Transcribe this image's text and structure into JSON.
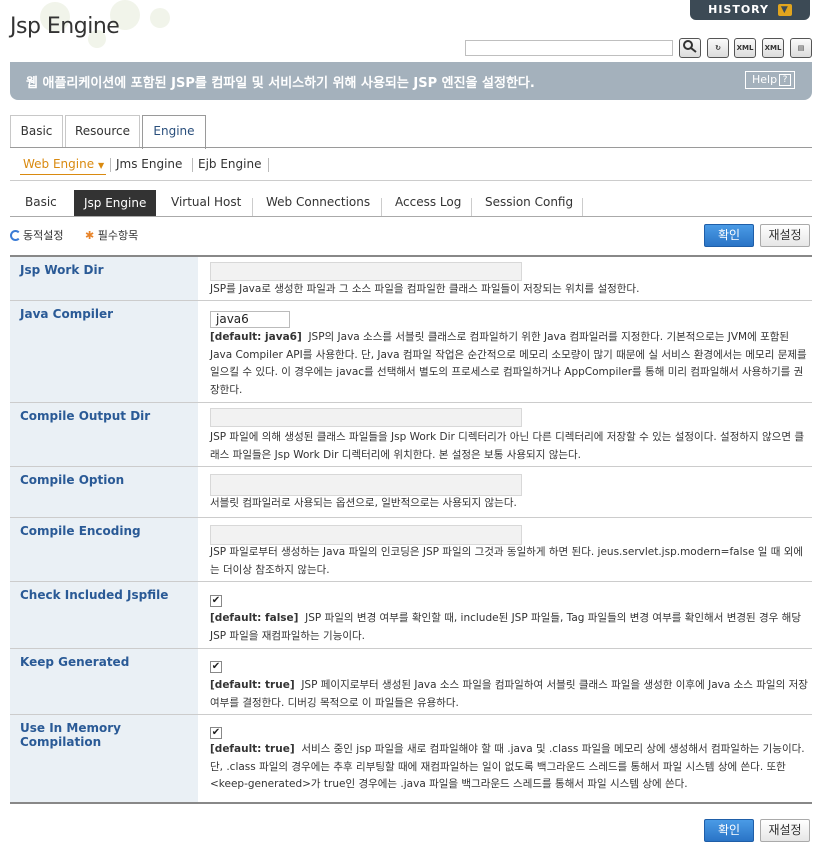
{
  "header": {
    "title": "Jsp Engine",
    "history_label": "HISTORY",
    "description": "웹 애플리케이션에 포함된 JSP를 컴파일 및 서비스하기 위해 사용되는 JSP 엔진을 설정한다.",
    "help_label": "Help",
    "toolbar_icons": [
      "search-icon",
      "refresh-icon",
      "xml-export-icon",
      "xml-view-icon",
      "print-icon"
    ]
  },
  "tabs_main": [
    "Basic",
    "Resource",
    "Engine"
  ],
  "tabs_main_active": "Engine",
  "subnav": [
    "Web Engine",
    "Jms Engine",
    "Ejb Engine"
  ],
  "subnav_active": "Web Engine",
  "tabs_sub": [
    "Basic",
    "Jsp Engine",
    "Virtual Host",
    "Web Connections",
    "Access Log",
    "Session Config"
  ],
  "tabs_sub_active": "Jsp Engine",
  "legend": {
    "dynamic": "동적설정",
    "required": "필수항목"
  },
  "buttons": {
    "confirm": "확인",
    "reset": "재설정"
  },
  "fields": [
    {
      "label": "Jsp Work Dir",
      "type": "text",
      "value": "",
      "default": "",
      "desc": "JSP를 Java로 생성한 파일과 그 소스 파일을 컴파일한 클래스 파일들이 저장되는 위치를 설정한다."
    },
    {
      "label": "Java Compiler",
      "type": "select",
      "value": "java6",
      "default": "[default: java6]",
      "desc": "JSP의 Java 소스를 서블릿 클래스로 컴파일하기 위한 Java 컴파일러를 지정한다. 기본적으로는 JVM에 포함된 Java Compiler API를 사용한다. 단, Java 컴파일 작업은 순간적으로 메모리 소모량이 많기 때문에 실 서비스 환경에서는 메모리 문제를 일으킬 수 있다. 이 경우에는 javac를 선택해서 별도의 프로세스로 컴파일하거나 AppCompiler를 통해 미리 컴파일해서 사용하기를 권장한다."
    },
    {
      "label": "Compile Output Dir",
      "type": "text",
      "value": "",
      "default": "",
      "desc": "JSP 파일에 의해 생성된 클래스 파일들을 Jsp Work Dir 디렉터리가 아닌 다른 디렉터리에 저장할 수 있는 설정이다. 설정하지 않으면 클래스 파일들은 Jsp Work Dir 디렉터리에 위치한다. 본 설정은 보통 사용되지 않는다."
    },
    {
      "label": "Compile Option",
      "type": "text",
      "value": "",
      "default": "",
      "desc": "서블릿 컴파일러로 사용되는 옵션으로, 일반적으로는 사용되지 않는다."
    },
    {
      "label": "Compile Encoding",
      "type": "text",
      "value": "",
      "default": "",
      "desc": "JSP 파일로부터 생성하는 Java 파일의 인코딩은 JSP 파일의 그것과 동일하게 하면 된다. jeus.servlet.jsp.modern=false 일 때 외에는 더이상 참조하지 않는다."
    },
    {
      "label": "Check Included Jspfile",
      "type": "checkbox",
      "value": "true",
      "default": "[default: false]",
      "desc": "JSP 파일의 변경 여부를 확인할 때, include된 JSP 파일들, Tag 파일들의 변경 여부를 확인해서 변경된 경우 해당 JSP 파일을 재컴파일하는 기능이다."
    },
    {
      "label": "Keep Generated",
      "type": "checkbox",
      "value": "true",
      "default": "[default: true]",
      "desc": "JSP 페이지로부터 생성된 Java 소스 파일을 컴파일하여 서블릿 클래스 파일을 생성한 이후에 Java 소스 파일의 저장 여부를 결정한다. 디버깅 목적으로 이 파일들은 유용하다."
    },
    {
      "label": "Use In Memory Compilation",
      "type": "checkbox",
      "value": "true",
      "default": "[default: true]",
      "desc": "서비스 중인 jsp 파일을 새로 컴파일해야 할 때 .java 및 .class 파일을 메모리 상에 생성해서 컴파일하는 기능이다. 단, .class 파일의 경우에는 추후 리부팅할 때에 재컴파일하는 일이 없도록 백그라운드 스레드를 통해서 파일 시스템 상에 쓴다. 또한 <keep-generated>가 true인 경우에는 .java 파일을 백그라운드 스레드를 통해서 파일 시스템 상에 쓴다."
    }
  ],
  "colors": {
    "desc_bar": "#a4b1bc",
    "label_bg": "#eaf0f5",
    "label_text": "#2a5a96",
    "active_subnav": "#d98a10",
    "confirm_btn": "#3a87d8"
  }
}
